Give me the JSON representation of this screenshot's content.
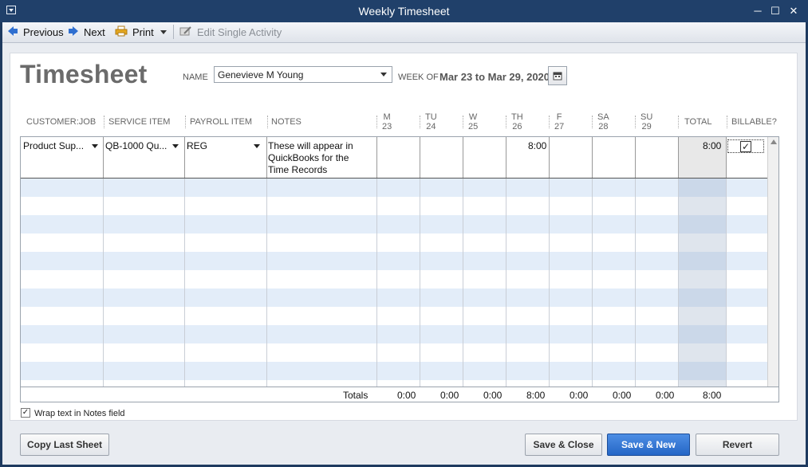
{
  "window": {
    "title": "Weekly Timesheet"
  },
  "toolbar": {
    "previous": "Previous",
    "next": "Next",
    "print": "Print",
    "edit_single": "Edit Single Activity"
  },
  "form": {
    "heading": "Timesheet",
    "name_label": "NAME",
    "name_value": "Genevieve M Young",
    "week_label": "WEEK OF",
    "week_value": "Mar 23 to Mar 29, 2020"
  },
  "columns": {
    "customer": "CUSTOMER:JOB",
    "service": "SERVICE ITEM",
    "payroll": "PAYROLL ITEM",
    "notes": "NOTES",
    "days": [
      {
        "d": "M",
        "n": "23"
      },
      {
        "d": "TU",
        "n": "24"
      },
      {
        "d": "W",
        "n": "25"
      },
      {
        "d": "TH",
        "n": "26"
      },
      {
        "d": "F",
        "n": "27"
      },
      {
        "d": "SA",
        "n": "28"
      },
      {
        "d": "SU",
        "n": "29"
      }
    ],
    "total": "TOTAL",
    "billable": "BILLABLE?"
  },
  "row1": {
    "customer": "Product Sup...",
    "service": "QB-1000 Qu...",
    "payroll": "REG",
    "notes_1": "These will appear in",
    "notes_2": "QuickBooks for the",
    "notes_3": "Time Records",
    "th": "8:00",
    "total": "8:00",
    "billable": true
  },
  "totals": {
    "label": "Totals",
    "m": "0:00",
    "tu": "0:00",
    "w": "0:00",
    "th": "8:00",
    "f": "0:00",
    "sa": "0:00",
    "su": "0:00",
    "total": "8:00"
  },
  "options": {
    "wrap_notes": "Wrap text in Notes field",
    "wrap_checked": true
  },
  "buttons": {
    "copy_last": "Copy Last Sheet",
    "save_close": "Save & Close",
    "save_new": "Save & New",
    "revert": "Revert"
  }
}
